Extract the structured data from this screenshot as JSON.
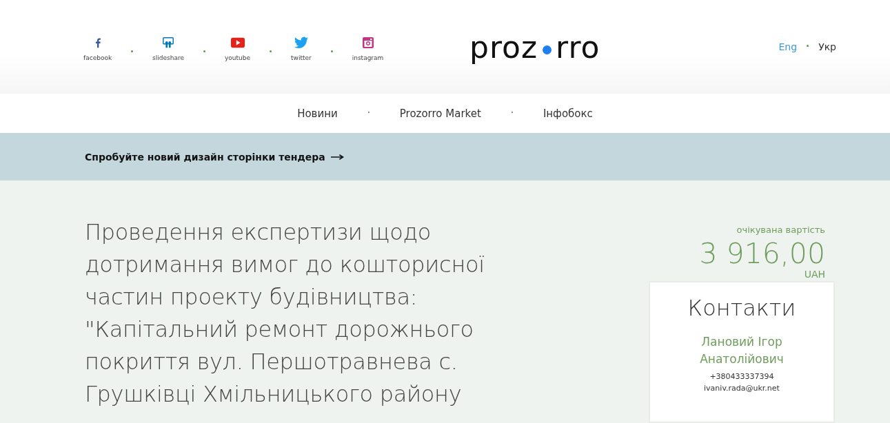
{
  "social_links": [
    {
      "kind": "facebook",
      "label": "facebook"
    },
    {
      "kind": "slideshare",
      "label": "slideshare"
    },
    {
      "kind": "youtube",
      "label": "youtube"
    },
    {
      "kind": "twitter",
      "label": "twitter"
    },
    {
      "kind": "instagram",
      "label": "instagram"
    }
  ],
  "logo": {
    "left": "proz",
    "right": "rro"
  },
  "languages": [
    {
      "label": "Eng",
      "selected": false
    },
    {
      "label": "Укр",
      "selected": true
    }
  ],
  "nav": [
    "Новини",
    "Prozorro Market",
    "Інфобокс"
  ],
  "banner": {
    "text": "Спробуйте новий дизайн сторінки тендера"
  },
  "tender": {
    "title": "Проведення експертизи щодо дотримання вимог до кошторисної частин проекту будівництва: \"Капітальний ремонт дорожнього покриття вул. Першотравнева с. Грушківці Хмільницького району",
    "value_label": "очікувана вартість",
    "amount": "3 916,00",
    "currency": "UAH"
  },
  "contacts": {
    "title": "Контакти",
    "name": "Лановий Ігор Анатолійович",
    "phone": "+380433337394",
    "email": "ivaniv.rada@ukr.net"
  }
}
